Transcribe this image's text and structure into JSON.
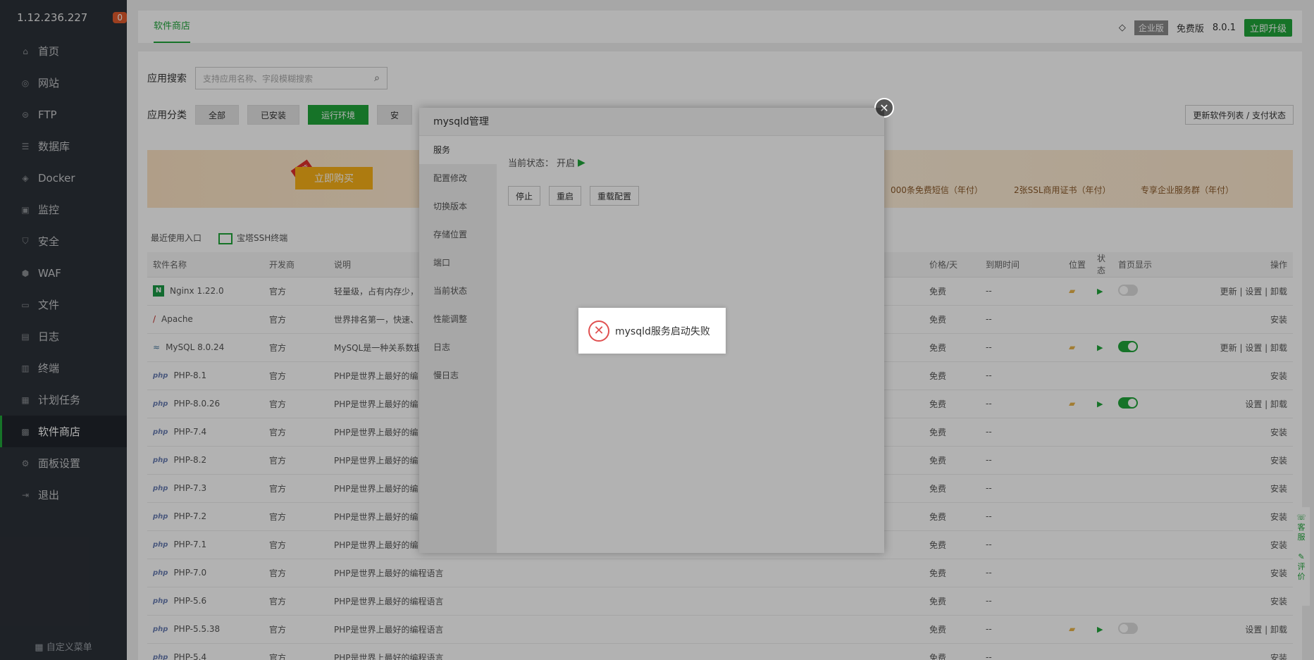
{
  "sidebar": {
    "ip": "1.12.236.227",
    "badge": "0",
    "items": [
      {
        "label": "首页",
        "icon": "home-icon"
      },
      {
        "label": "网站",
        "icon": "globe-icon"
      },
      {
        "label": "FTP",
        "icon": "ftp-icon"
      },
      {
        "label": "数据库",
        "icon": "database-icon"
      },
      {
        "label": "Docker",
        "icon": "docker-icon"
      },
      {
        "label": "监控",
        "icon": "monitor-icon"
      },
      {
        "label": "安全",
        "icon": "shield-icon"
      },
      {
        "label": "WAF",
        "icon": "waf-icon"
      },
      {
        "label": "文件",
        "icon": "folder-icon"
      },
      {
        "label": "日志",
        "icon": "log-icon"
      },
      {
        "label": "终端",
        "icon": "terminal-icon"
      },
      {
        "label": "计划任务",
        "icon": "calendar-icon"
      },
      {
        "label": "软件商店",
        "icon": "grid-icon"
      },
      {
        "label": "面板设置",
        "icon": "gear-icon"
      },
      {
        "label": "退出",
        "icon": "logout-icon"
      }
    ],
    "footer": "自定义菜单"
  },
  "topbar": {
    "tab": "软件商店",
    "enterprise": "企业版",
    "free": "免费版",
    "version": "8.0.1",
    "upgrade": "立即升级"
  },
  "filters": {
    "search_label": "应用搜索",
    "search_placeholder": "支持应用名称、字段模糊搜索",
    "category_label": "应用分类",
    "categories": [
      "全部",
      "已安装",
      "运行环境",
      "安"
    ],
    "refresh": "更新软件列表 / 支付状态"
  },
  "banner": {
    "tag": "推荐",
    "buy": "立即购买",
    "item1": "000条免费短信（年付）",
    "item2": "2张SSL商用证书（年付）",
    "item3": "专享企业服务群（年付）"
  },
  "recent": {
    "label": "最近使用入口",
    "ssh": "宝塔SSH终端"
  },
  "table": {
    "headers": [
      "软件名称",
      "开发商",
      "说明",
      "价格/天",
      "到期时间",
      "位置",
      "状态",
      "首页显示",
      "操作"
    ],
    "rows": [
      {
        "name": "Nginx 1.22.0",
        "dev": "官方",
        "desc": "轻量级，占有内存少，",
        "price": "免费",
        "expire": "--",
        "op": "更新 | 设置 | 卸载"
      },
      {
        "name": "Apache",
        "dev": "官方",
        "desc": "世界排名第一，快速、",
        "price": "免费",
        "expire": "--",
        "op": "安装"
      },
      {
        "name": "MySQL 8.0.24",
        "dev": "官方",
        "desc": "MySQL是一种关系数据",
        "price": "免费",
        "expire": "--",
        "op": "更新 | 设置 | 卸载"
      },
      {
        "name": "PHP-8.1",
        "dev": "官方",
        "desc": "PHP是世界上最好的编",
        "price": "免费",
        "expire": "--",
        "op": "安装"
      },
      {
        "name": "PHP-8.0.26",
        "dev": "官方",
        "desc": "PHP是世界上最好的编",
        "price": "免费",
        "expire": "--",
        "op": "设置 | 卸载"
      },
      {
        "name": "PHP-7.4",
        "dev": "官方",
        "desc": "PHP是世界上最好的编",
        "price": "免费",
        "expire": "--",
        "op": "安装"
      },
      {
        "name": "PHP-8.2",
        "dev": "官方",
        "desc": "PHP是世界上最好的编",
        "price": "免费",
        "expire": "--",
        "op": "安装"
      },
      {
        "name": "PHP-7.3",
        "dev": "官方",
        "desc": "PHP是世界上最好的编",
        "price": "免费",
        "expire": "--",
        "op": "安装"
      },
      {
        "name": "PHP-7.2",
        "dev": "官方",
        "desc": "PHP是世界上最好的编",
        "price": "免费",
        "expire": "--",
        "op": "安装"
      },
      {
        "name": "PHP-7.1",
        "dev": "官方",
        "desc": "PHP是世界上最好的编",
        "price": "免费",
        "expire": "--",
        "op": "安装"
      },
      {
        "name": "PHP-7.0",
        "dev": "官方",
        "desc": "PHP是世界上最好的编程语言",
        "price": "免费",
        "expire": "--",
        "op": "安装"
      },
      {
        "name": "PHP-5.6",
        "dev": "官方",
        "desc": "PHP是世界上最好的编程语言",
        "price": "免费",
        "expire": "--",
        "op": "安装"
      },
      {
        "name": "PHP-5.5.38",
        "dev": "官方",
        "desc": "PHP是世界上最好的编程语言",
        "price": "免费",
        "expire": "--",
        "op": "设置 | 卸载"
      },
      {
        "name": "PHP-5.4",
        "dev": "官方",
        "desc": "PHP是世界上最好的编程语言",
        "price": "免费",
        "expire": "--",
        "op": "安装"
      }
    ]
  },
  "float_side": {
    "service": "客服",
    "review": "评价"
  },
  "modal": {
    "title": "mysqld管理",
    "nav": [
      "服务",
      "配置修改",
      "切换版本",
      "存储位置",
      "端口",
      "当前状态",
      "性能调整",
      "日志",
      "慢日志"
    ],
    "status_label": "当前状态：",
    "status_value": "开启",
    "buttons": [
      "停止",
      "重启",
      "重载配置"
    ]
  },
  "toast": {
    "message": "mysqld服务启动失败"
  }
}
